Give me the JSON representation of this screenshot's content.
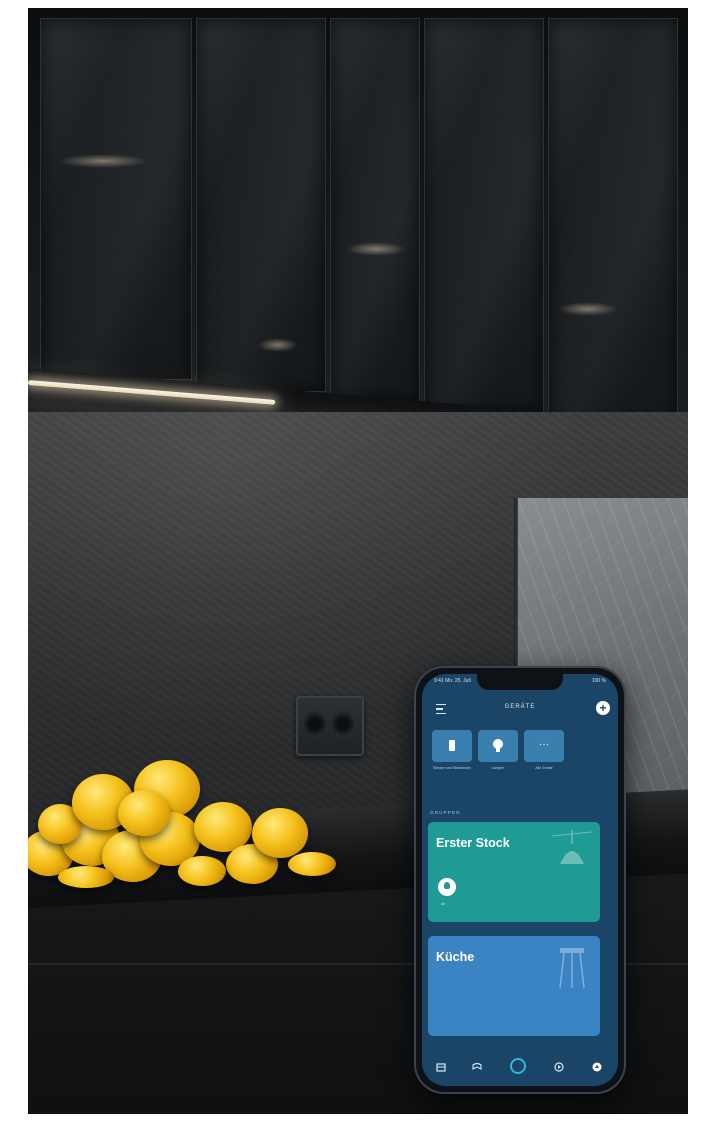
{
  "app": {
    "status_time": "9:41 Mo. 25. Juli",
    "status_right": "100 %",
    "header_title": "GERÄTE",
    "add_label": "+"
  },
  "quick_access": [
    {
      "label": "Stecker und Steckdosen",
      "icon": "plug-icon"
    },
    {
      "label": "Lampen",
      "icon": "bulb-icon"
    },
    {
      "label": "Alle Geräte",
      "icon": "more-icon"
    }
  ],
  "groups_label": "GRUPPEN",
  "groups": [
    {
      "title": "Erster Stock",
      "device_label": "An",
      "color": "#1f9a95"
    },
    {
      "title": "Küche",
      "color": "#3a84c4"
    }
  ],
  "bottom_nav": [
    {
      "name": "home-icon"
    },
    {
      "name": "communicate-icon"
    },
    {
      "name": "alexa-icon"
    },
    {
      "name": "play-icon"
    },
    {
      "name": "devices-icon"
    }
  ],
  "colors": {
    "screen_bg": "#1b4566",
    "accent": "#32b4e6",
    "card_teal": "#1f9a95",
    "card_blue": "#3a84c4",
    "lemon": "#f6c21e"
  }
}
